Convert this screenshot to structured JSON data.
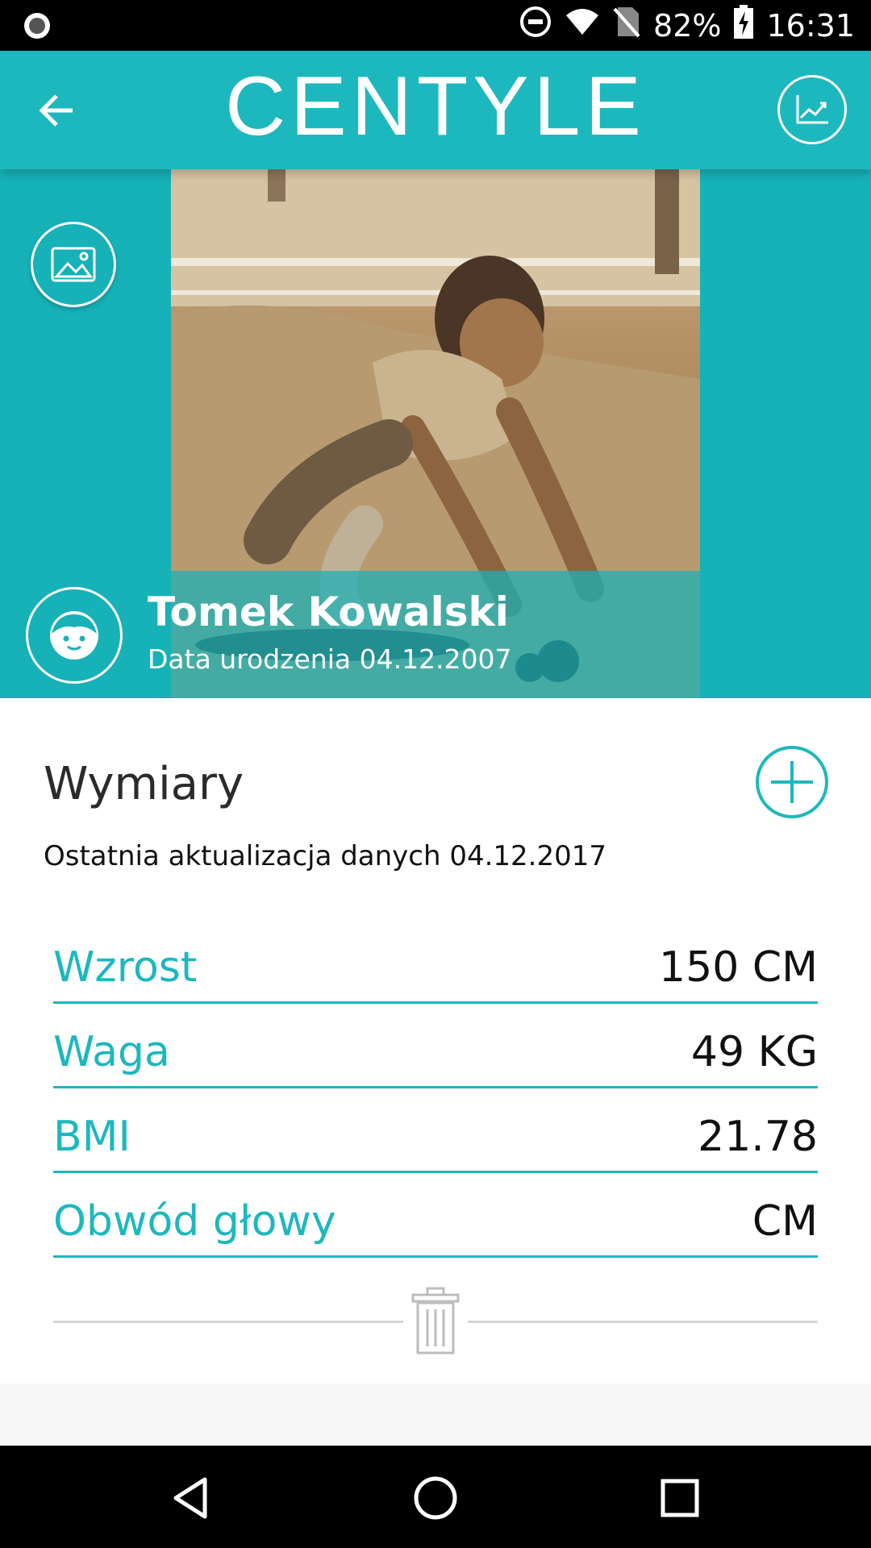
{
  "status_bar": {
    "battery": "82%",
    "time": "16:31"
  },
  "app_bar": {
    "brand": "CENTYLE"
  },
  "profile": {
    "name": "Tomek Kowalski",
    "birth_line": "Data urodzenia 04.12.2007"
  },
  "measurements": {
    "title": "Wymiary",
    "last_update": "Ostatnia aktualizacja danych 04.12.2017",
    "rows": [
      {
        "label": "Wzrost",
        "value": "150 CM"
      },
      {
        "label": "Waga",
        "value": "49 KG"
      },
      {
        "label": "BMI",
        "value": "21.78"
      },
      {
        "label": "Obwód głowy",
        "value": "CM"
      }
    ]
  },
  "colors": {
    "accent": "#1db8bd",
    "text": "#111111",
    "divider": "#d6d6d6"
  },
  "icons": {
    "back": "arrow-left-icon",
    "chart": "chart-icon",
    "gallery": "image-icon",
    "avatar": "face-icon",
    "add": "plus-circle-icon",
    "delete": "trash-icon"
  }
}
